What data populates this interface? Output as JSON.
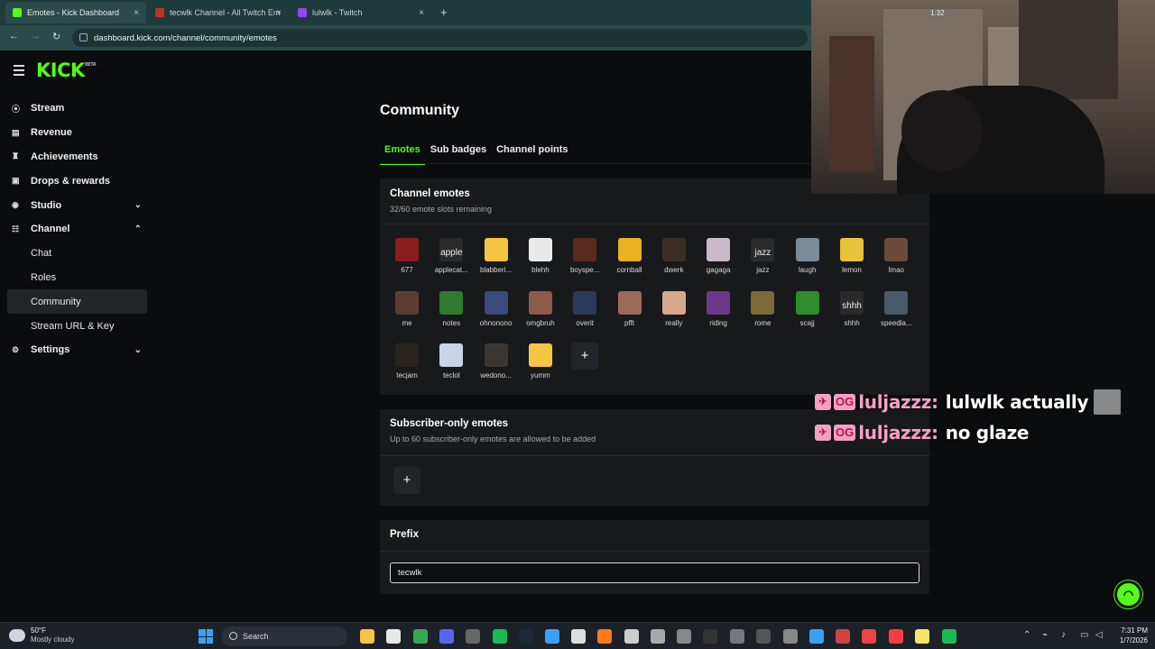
{
  "browser": {
    "tabs": [
      {
        "title": "Emotes - Kick Dashboard",
        "color": "#53fc18",
        "active": true
      },
      {
        "title": "tecwlk Channel - All Twitch Em",
        "color": "#c4302b",
        "active": false
      },
      {
        "title": "lulwlk - Twitch",
        "color": "#9146ff",
        "active": false
      }
    ],
    "new_tab": "+",
    "close": "×",
    "url": "dashboard.kick.com/channel/community/emotes"
  },
  "brand": {
    "logo": "KICK",
    "beta": "BETA",
    "accent": "#53fc18"
  },
  "sidebar": {
    "items": [
      {
        "label": "Stream",
        "icon": "broadcast-icon",
        "glyph": "((•))"
      },
      {
        "label": "Revenue",
        "icon": "chart-icon",
        "glyph": "▮"
      },
      {
        "label": "Achievements",
        "icon": "trophy-icon",
        "glyph": "🏆"
      },
      {
        "label": "Drops & rewards",
        "icon": "gift-icon",
        "glyph": "▣"
      },
      {
        "label": "Studio",
        "icon": "studio-icon",
        "glyph": "◉",
        "chevron": "⌄"
      },
      {
        "label": "Channel",
        "icon": "users-icon",
        "glyph": "☷",
        "chevron": "⌃"
      }
    ],
    "sub_items": [
      "Chat",
      "Roles",
      "Community",
      "Stream URL & Key"
    ],
    "settings": {
      "label": "Settings",
      "icon": "gear-icon",
      "glyph": "⚙",
      "chevron": "⌄"
    }
  },
  "main": {
    "title": "Community",
    "tabs": [
      "Emotes",
      "Sub badges",
      "Channel points"
    ],
    "channel_emotes": {
      "title": "Channel emotes",
      "subtitle": "32/60 emote slots remaining",
      "emotes": [
        {
          "name": "677",
          "color": "#8a1d1d"
        },
        {
          "name": "applecat",
          "color": "#2a2a2a",
          "alt": "apple"
        },
        {
          "name": "blabbering",
          "color": "#f5c542"
        },
        {
          "name": "blehh",
          "color": "#e9e9e9"
        },
        {
          "name": "boyspeak",
          "color": "#5a2a1e"
        },
        {
          "name": "cornball",
          "color": "#e8b222"
        },
        {
          "name": "dwerk",
          "color": "#3b2f25"
        },
        {
          "name": "gagaga",
          "color": "#c9b9c9"
        },
        {
          "name": "jazz",
          "color": "#2a2a2a",
          "alt": "jazz"
        },
        {
          "name": "laugh",
          "color": "#7a8a99"
        },
        {
          "name": "lemon",
          "color": "#e8c23a"
        },
        {
          "name": "lmao",
          "color": "#6b4a3a"
        },
        {
          "name": "me",
          "color": "#5a3d2e"
        },
        {
          "name": "notes",
          "color": "#2f7a2f"
        },
        {
          "name": "ohnonono",
          "color": "#3a4a7a"
        },
        {
          "name": "omgbruh",
          "color": "#8a5a4a"
        },
        {
          "name": "overit",
          "color": "#2a3a5a"
        },
        {
          "name": "pfft",
          "color": "#9a6a5a"
        },
        {
          "name": "really",
          "color": "#d8a88a"
        },
        {
          "name": "riding",
          "color": "#6a3a8a"
        },
        {
          "name": "rome",
          "color": "#7a6a3a"
        },
        {
          "name": "scajj",
          "color": "#2e8b2e"
        },
        {
          "name": "shhh",
          "color": "#2a2a2a",
          "alt": "shhh"
        },
        {
          "name": "speedlaugh",
          "color": "#4a5a6a"
        },
        {
          "name": "tecjam",
          "color": "#2a241f"
        },
        {
          "name": "teclol",
          "color": "#c9d4e8"
        },
        {
          "name": "wedontcare",
          "color": "#3a3531"
        },
        {
          "name": "yumm",
          "color": "#f5c542"
        }
      ],
      "display_names": [
        "677",
        "applecat...",
        "blabberi...",
        "blehh",
        "boyspe...",
        "cornball",
        "dwerk",
        "gagaga",
        "jazz",
        "laugh",
        "lemon",
        "lmao",
        "me",
        "notes",
        "ohnonono",
        "omgbruh",
        "overit",
        "pfft",
        "really",
        "riding",
        "rome",
        "scajj",
        "shhh",
        "speedla...",
        "tecjam",
        "teclol",
        "wedono...",
        "yumm"
      ],
      "add_label": "+"
    },
    "subscriber_emotes": {
      "title": "Subscriber-only emotes",
      "subtitle": "Up to 60 subscriber-only emotes are allowed to be added",
      "add_label": "+"
    },
    "prefix": {
      "title": "Prefix",
      "value": "tecwlk"
    }
  },
  "overlay": {
    "webcam_clock": "1:32",
    "chat": [
      {
        "badge": "OG",
        "user": "luljazzz:",
        "message": "lulwlk actually",
        "has_emote": true
      },
      {
        "badge": "OG",
        "user": "luljazzz:",
        "message": "no glaze",
        "has_emote": false
      }
    ],
    "user_color": "#f3a0c4"
  },
  "taskbar": {
    "weather_temp": "50°F",
    "weather_desc": "Mostly cloudy",
    "search": "Search",
    "time": "7:31 PM",
    "date": "1/7/2026"
  }
}
